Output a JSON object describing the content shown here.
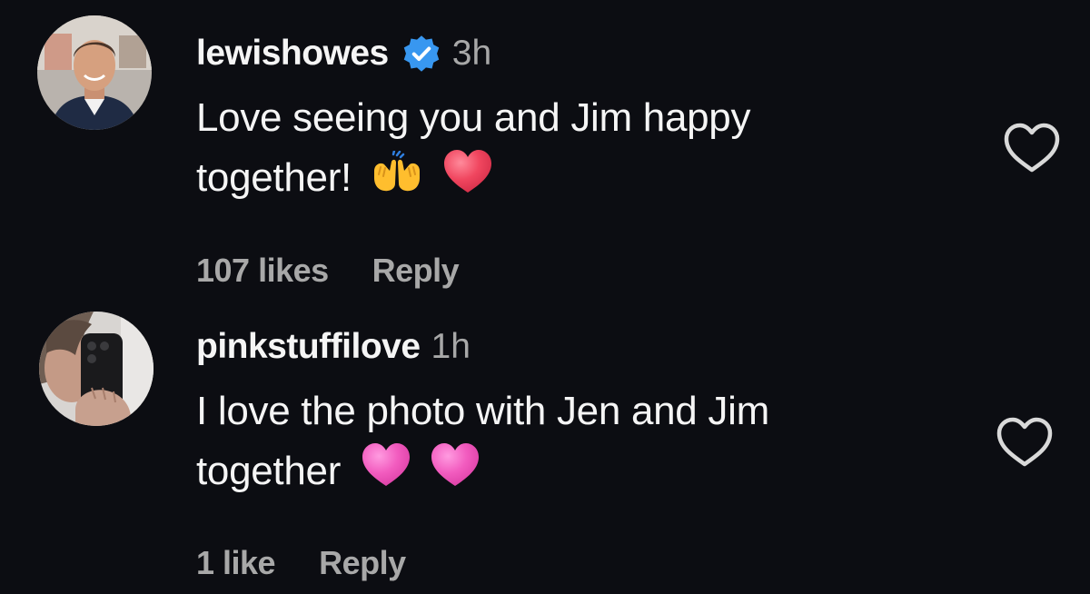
{
  "comments": [
    {
      "username": "lewishowes",
      "verified": true,
      "time": "3h",
      "text": "Love seeing you and Jim happy together!",
      "line1": "Love seeing you and Jim happy",
      "line2": "together!",
      "emojis": [
        "raising-hands-emoji",
        "red-heart-emoji"
      ],
      "likes": "107 likes",
      "reply": "Reply",
      "liked": false
    },
    {
      "username": "pinkstuffilove",
      "verified": false,
      "time": "1h",
      "text": "I love the photo with Jen and Jim together",
      "line1": "I love the photo with Jen and Jim",
      "line2": "together",
      "emojis": [
        "pink-heart-emoji",
        "pink-heart-emoji"
      ],
      "likes": "1 like",
      "reply": "Reply",
      "liked": false
    }
  ],
  "colors": {
    "background": "#0c0d12",
    "primary_text": "#f5f5f5",
    "secondary_text": "#a8a8a8",
    "verified_badge": "#3897f0",
    "red_heart": "#ef3d5a",
    "pink_heart": "#f05bb8"
  }
}
